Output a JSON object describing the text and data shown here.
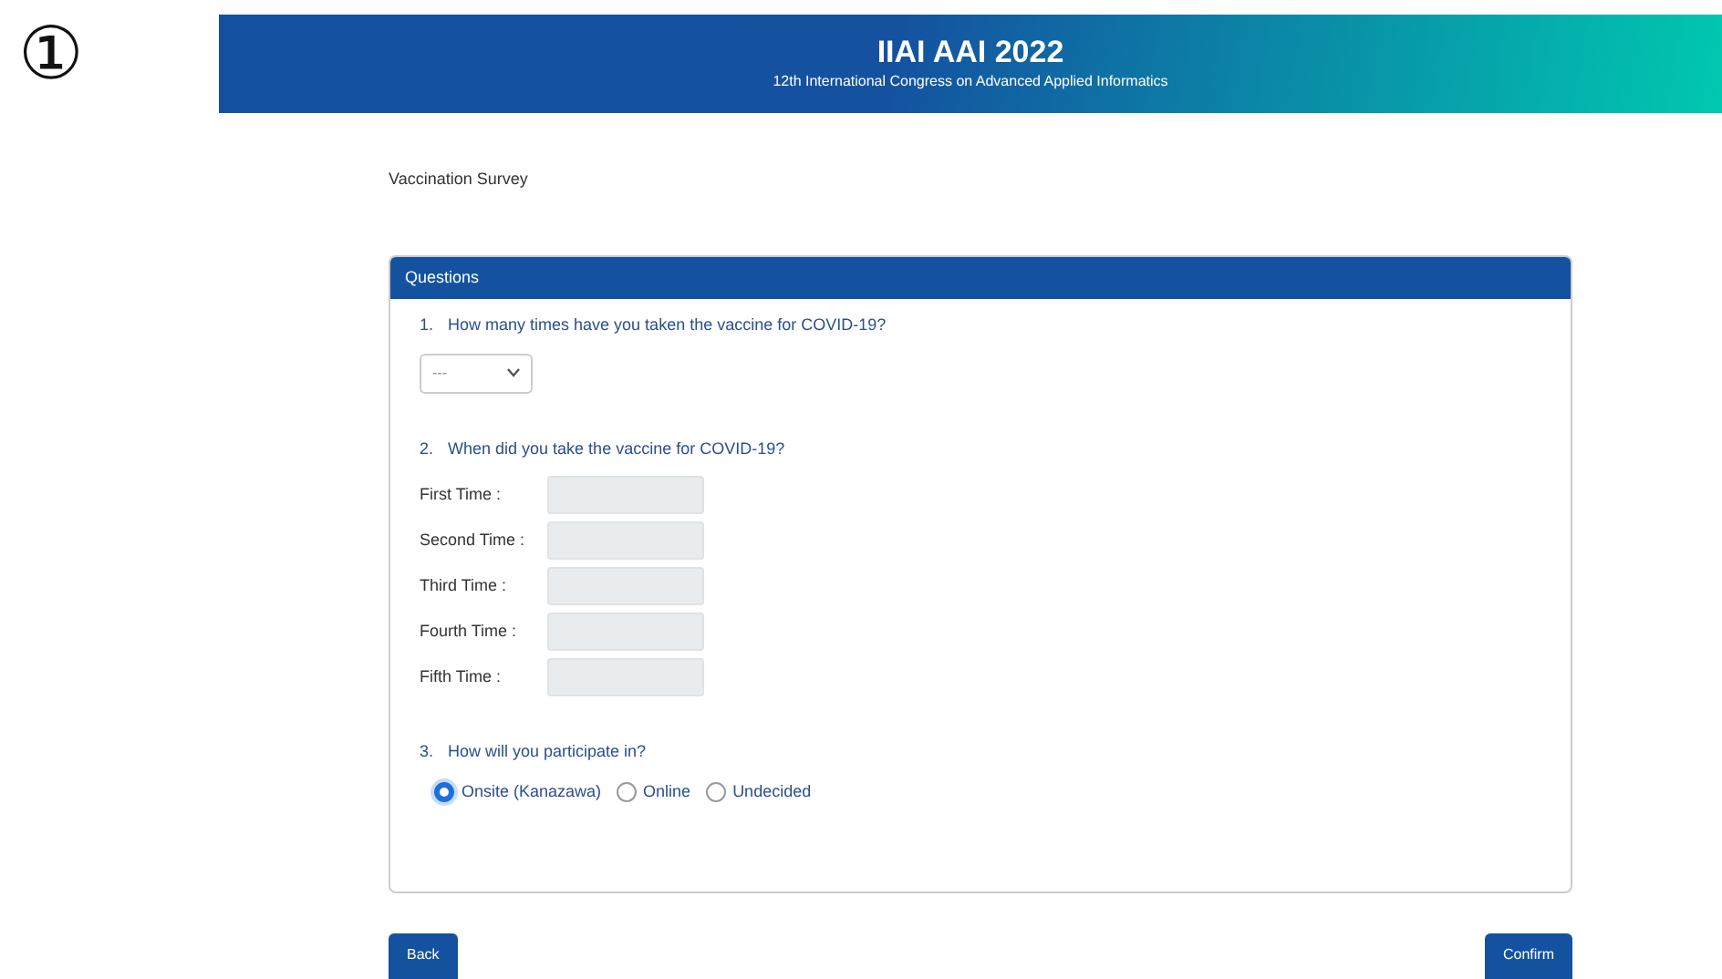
{
  "step_mark": "①",
  "banner": {
    "title": "IIAI AAI 2022",
    "subtitle": "12th International Congress on Advanced Applied Informatics"
  },
  "page_title": "Vaccination Survey",
  "card": {
    "header": "Questions",
    "questions": [
      {
        "kind": "select",
        "number": "1.",
        "text": "How many times have you taken the vaccine for COVID-19?",
        "value": "---"
      },
      {
        "kind": "dates",
        "number": "2.",
        "text": "When did you take the vaccine for COVID-19?",
        "fields": [
          {
            "label": "First Time :"
          },
          {
            "label": "Second Time :"
          },
          {
            "label": "Third Time :"
          },
          {
            "label": "Fourth Time :"
          },
          {
            "label": "Fifth Time :"
          }
        ]
      },
      {
        "kind": "radio",
        "number": "3.",
        "text": "How will you participate in?",
        "options": [
          {
            "label": "Onsite (Kanazawa)",
            "selected": true
          },
          {
            "label": "Online",
            "selected": false
          },
          {
            "label": "Undecided",
            "selected": false
          }
        ]
      }
    ]
  },
  "buttons": [
    {
      "label": "Back"
    },
    {
      "label": "Confirm"
    }
  ]
}
